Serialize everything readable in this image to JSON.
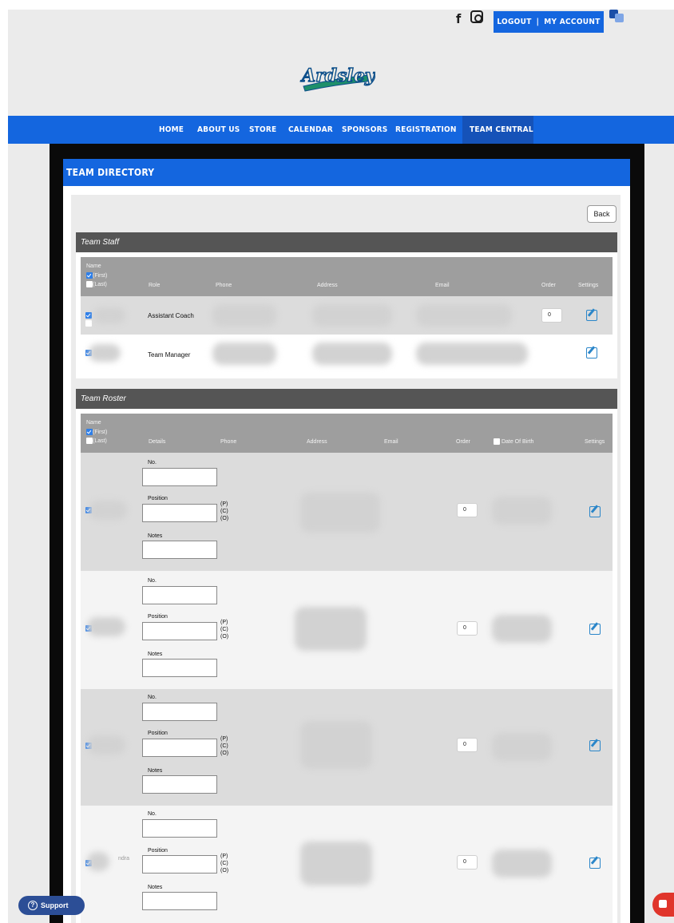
{
  "header": {
    "facebook_glyph": "f",
    "account": {
      "logout": "LOGOUT",
      "separator": "|",
      "my_account": "MY ACCOUNT"
    },
    "logo_text": "Ardsley"
  },
  "nav": {
    "items": [
      "HOME",
      "ABOUT US",
      "STORE",
      "CALENDAR",
      "SPONSORS",
      "REGISTRATION",
      "TEAM CENTRAL"
    ],
    "active": "TEAM CENTRAL"
  },
  "page": {
    "title": "TEAM DIRECTORY",
    "back_label": "Back"
  },
  "staff": {
    "title": "Team Staff",
    "headers": {
      "name": "Name",
      "first": "(First)",
      "last": "(Last)",
      "role": "Role",
      "phone": "Phone",
      "address": "Address",
      "email": "Email",
      "order": "Order",
      "settings": "Settings"
    },
    "rows": [
      {
        "role": "Assistant Coach",
        "order": "0"
      },
      {
        "role": "Team Manager",
        "order": ""
      }
    ]
  },
  "roster": {
    "title": "Team Roster",
    "headers": {
      "name": "Name",
      "first": "(First)",
      "last": "(Last)",
      "details": "Details",
      "phone": "Phone",
      "address": "Address",
      "email": "Email",
      "order": "Order",
      "dob": "Date Of Birth",
      "settings": "Settings"
    },
    "labels": {
      "no": "No.",
      "position": "Position",
      "notes": "Notes",
      "p": "(P)",
      "c": "(C)",
      "o": "(O)"
    },
    "rows": [
      {
        "order": "0"
      },
      {
        "order": "0"
      },
      {
        "order": "0"
      },
      {
        "order": "0",
        "name_fragment": "ndra"
      }
    ]
  },
  "support": {
    "label": "Support",
    "icon": "question-circle-icon"
  },
  "colors": {
    "brand_blue": "#1466df",
    "section_gray": "#555555",
    "support_navy": "#2c4e96",
    "chat_red": "#e0352b"
  }
}
